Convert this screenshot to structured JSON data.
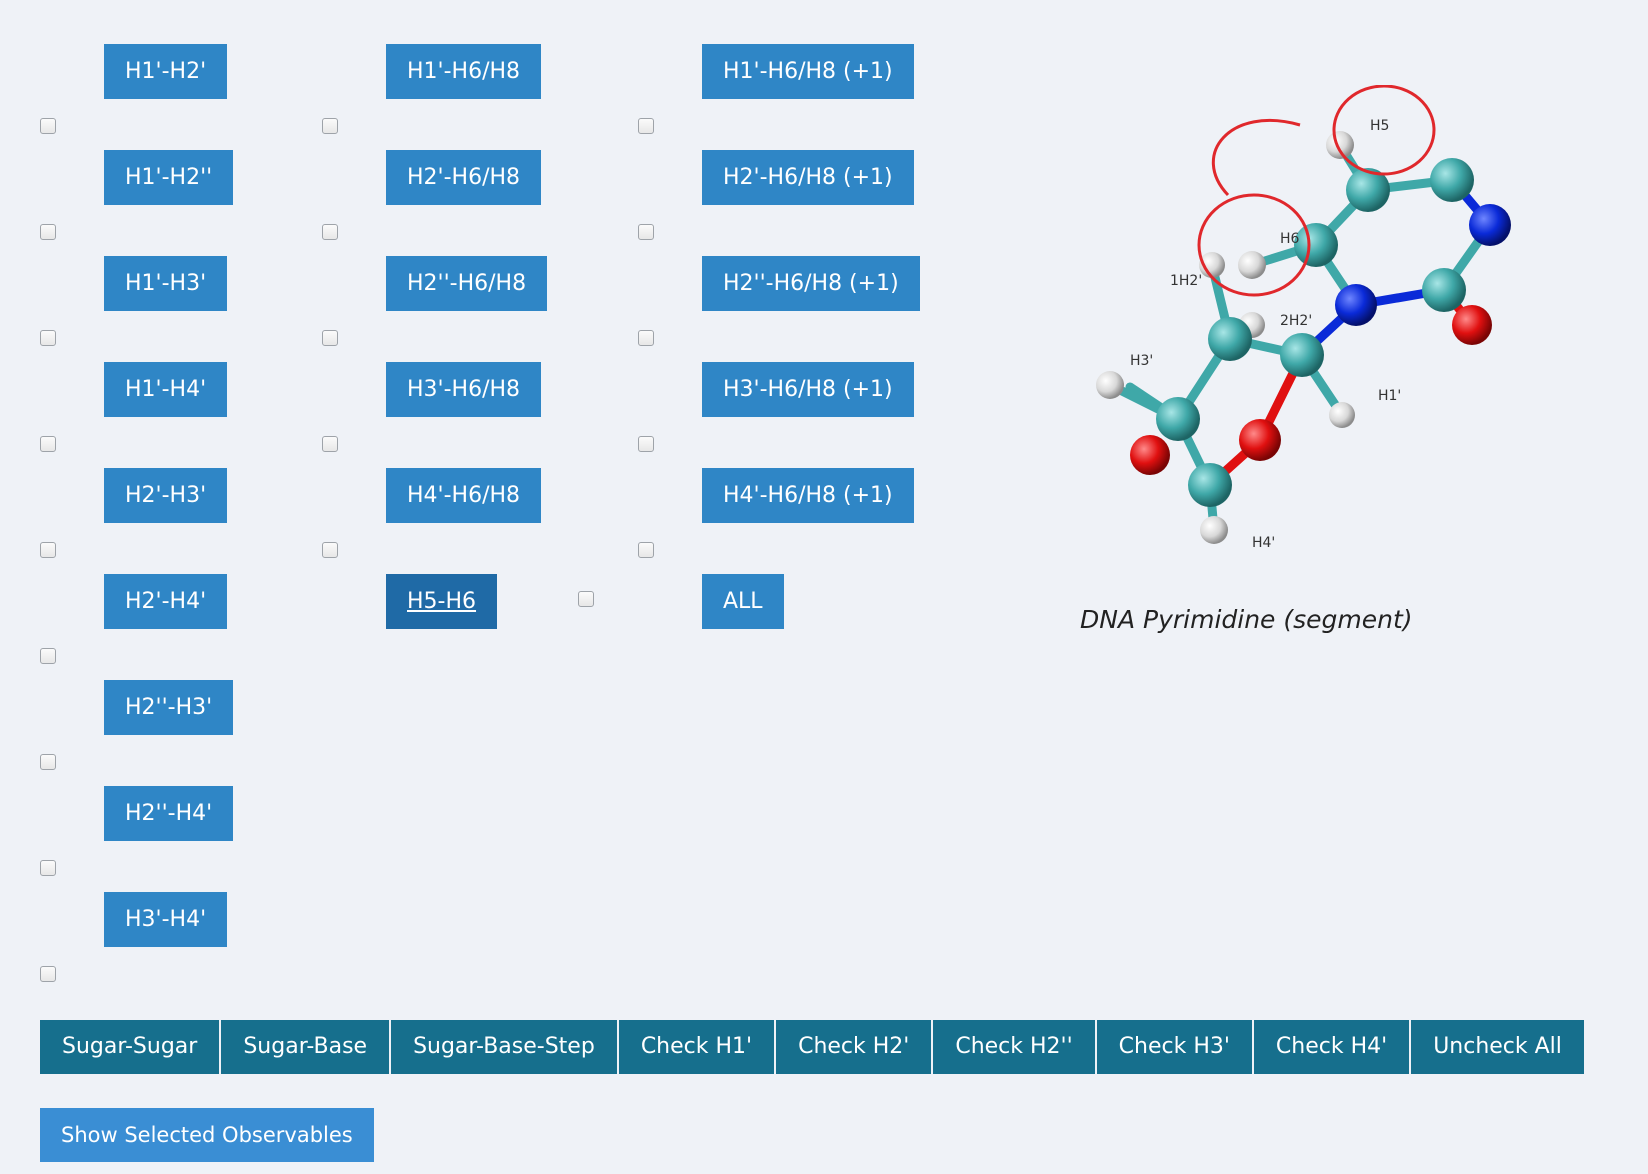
{
  "columns": [
    {
      "buttons": [
        "H1'-H2'",
        "H1'-H2''",
        "H1'-H3'",
        "H1'-H4'",
        "H2'-H3'",
        "H2'-H4'",
        "H2''-H3'",
        "H2''-H4'",
        "H3'-H4'"
      ]
    },
    {
      "buttons": [
        "H1'-H6/H8",
        "H2'-H6/H8",
        "H2''-H6/H8",
        "H3'-H6/H8",
        "H4'-H6/H8",
        "H5-H6"
      ]
    },
    {
      "buttons": [
        "H1'-H6/H8 (+1)",
        "H2'-H6/H8 (+1)",
        "H2''-H6/H8 (+1)",
        "H3'-H6/H8 (+1)",
        "H4'-H6/H8 (+1)",
        "ALL"
      ]
    }
  ],
  "group_buttons": [
    "Sugar-Sugar",
    "Sugar-Base",
    "Sugar-Base-Step",
    "Check H1'",
    "Check H2'",
    "Check H2''",
    "Check H3'",
    "Check H4'",
    "Uncheck All"
  ],
  "show_button": "Show Selected Observables",
  "figure": {
    "caption": "DNA Pyrimidine (segment)",
    "atom_labels": {
      "h5": "H5",
      "h6": "H6",
      "h1h2": "1H2'",
      "h2h2": "2H2'",
      "h3": "H3'",
      "h1p": "H1'",
      "h4": "H4'"
    },
    "colors": {
      "carbon": "#3fa8a8",
      "nitrogen": "#0a2ad8",
      "oxygen": "#e01010",
      "hydrogen": "#e8e8e8",
      "highlight": "#e0282c"
    }
  },
  "colors": {
    "obs_button": "#2f86c6",
    "obs_button_active": "#1f6aa6",
    "group_button": "#166f8d",
    "show_button": "#3a8ed4",
    "background": "#eff2f7"
  }
}
